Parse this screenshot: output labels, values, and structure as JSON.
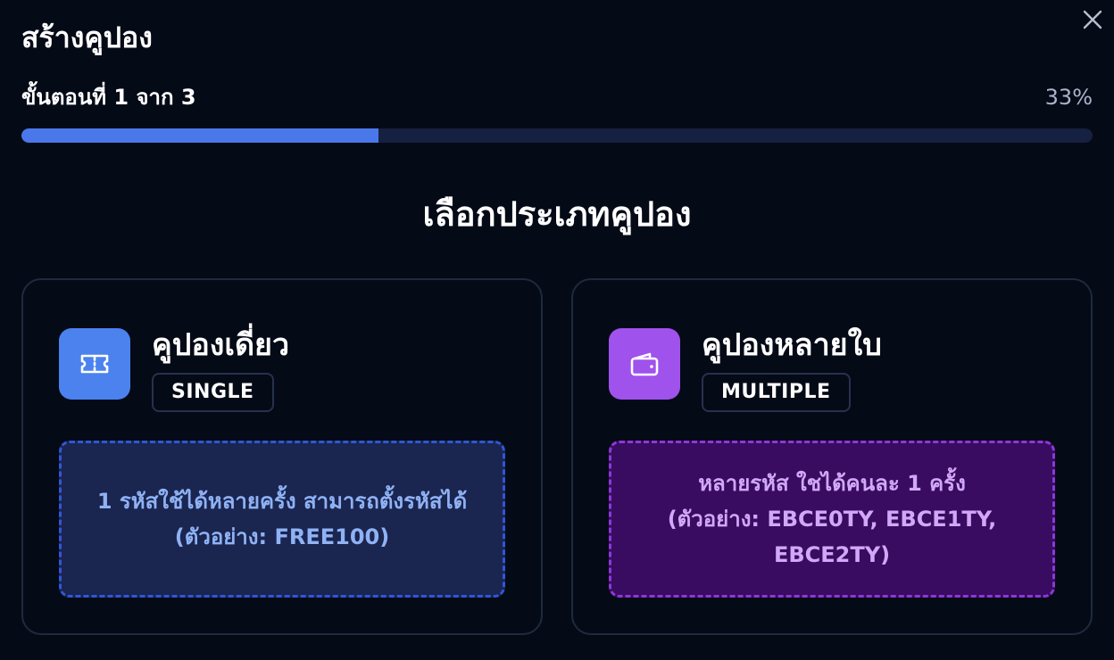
{
  "dialog": {
    "title": "สร้างคูปอง",
    "close_icon": "close-icon"
  },
  "progress": {
    "step_text": "ขั้นตอนที่ 1 จาก 3",
    "percent_text": "33%",
    "fraction": 0.3333,
    "fill_color": "#4a78ea"
  },
  "section": {
    "heading": "เลือกประเภทคูปอง"
  },
  "cards": [
    {
      "name": "คูปองเดี่ยว",
      "badge": "SINGLE",
      "icon": "ticket-icon",
      "icon_color": "#4b82ee",
      "desc_line1": "1 รหัสใช้ได้หลายครั้ง สามารถตั้งรหัสได้",
      "desc_line2": "(ตัวอย่าง: FREE100)"
    },
    {
      "name": "คูปองหลายใบ",
      "badge": "MULTIPLE",
      "icon": "wallet-icon",
      "icon_color": "#a052ec",
      "desc_line1": "หลายรหัส ใชได้คนละ 1 ครั้ง",
      "desc_line2": "(ตัวอย่าง: EBCE0TY, EBCE1TY, EBCE2TY)"
    }
  ]
}
